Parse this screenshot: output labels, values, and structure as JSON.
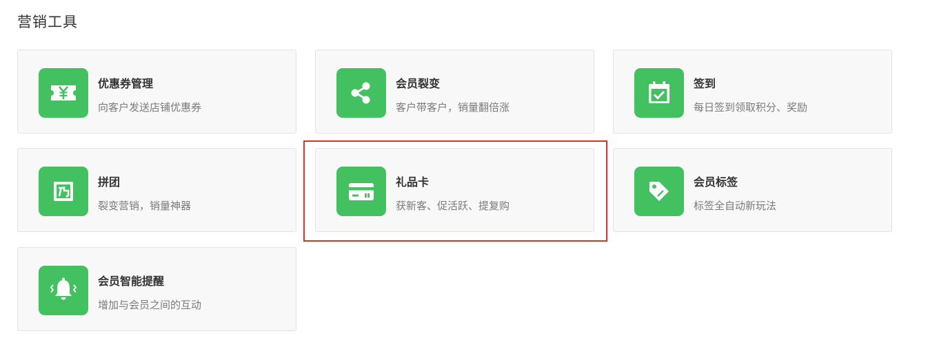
{
  "page": {
    "title": "营销工具"
  },
  "tools": [
    {
      "title": "优惠券管理",
      "desc": "向客户发送店铺优惠券",
      "icon": "coupon-icon"
    },
    {
      "title": "会员裂变",
      "desc": "客户带客户，销量翻倍涨",
      "icon": "share-icon"
    },
    {
      "title": "签到",
      "desc": "每日签到领取积分、奖励",
      "icon": "calendar-check-icon"
    },
    {
      "title": "拼团",
      "desc": "裂变营销，销量神器",
      "icon": "group-buy-icon"
    },
    {
      "title": "礼品卡",
      "desc": "获新客、促活跃、提复购",
      "icon": "gift-card-icon"
    },
    {
      "title": "会员标签",
      "desc": "标签全自动新玩法",
      "icon": "tag-icon"
    },
    {
      "title": "会员智能提醒",
      "desc": "增加与会员之间的互动",
      "icon": "bell-icon"
    }
  ],
  "selected_tool": "礼品卡",
  "colors": {
    "icon_bg": "#43c160",
    "card_bg": "#f8f8f8",
    "card_border": "#e3e3e3",
    "highlight": "#e02f20",
    "title_text": "#333333",
    "desc_text": "#7a7a7a"
  }
}
